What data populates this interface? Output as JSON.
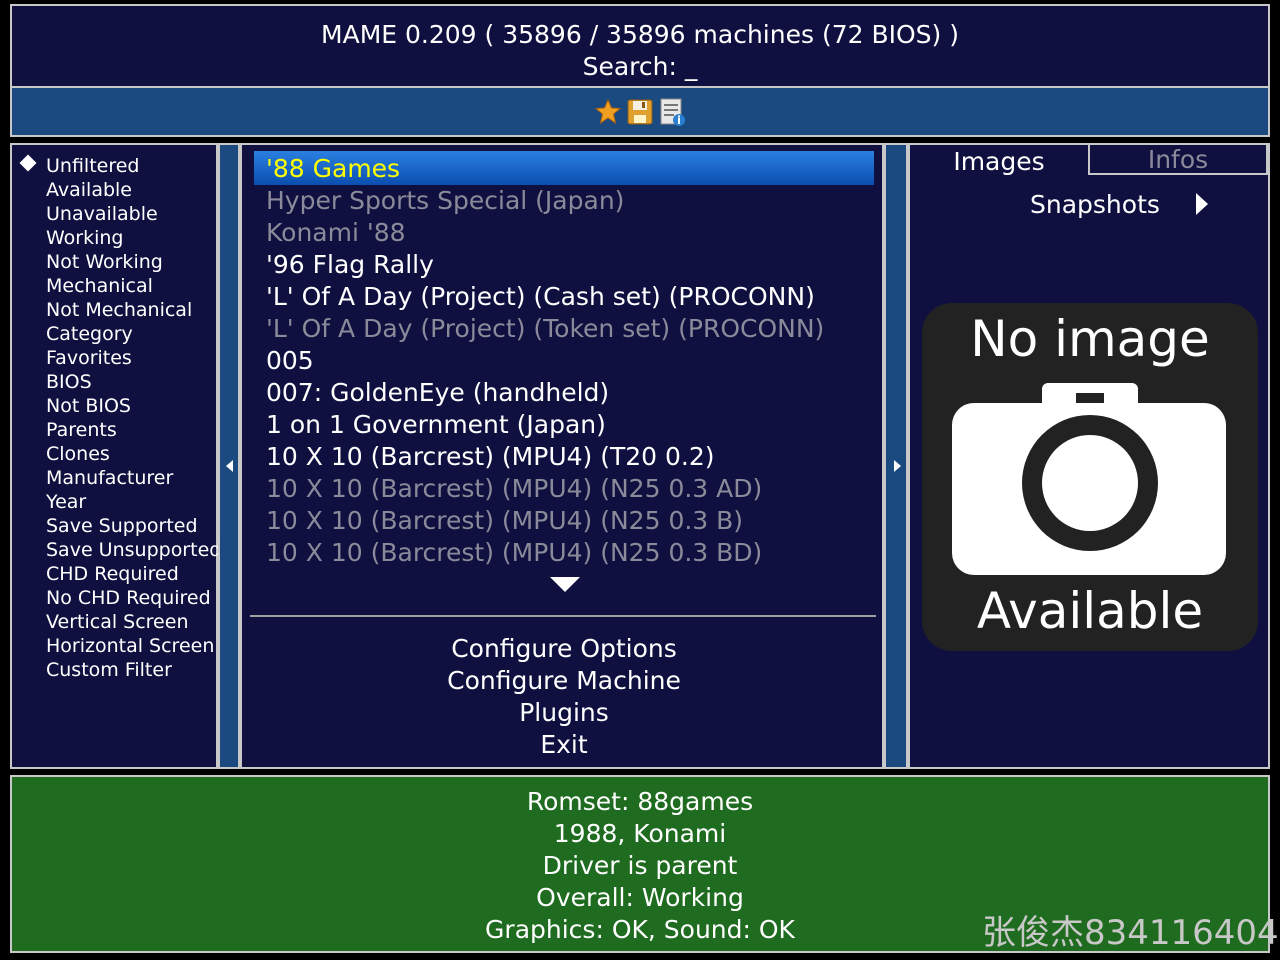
{
  "header": {
    "title": "MAME 0.209 ( 35896 / 35896 machines (72 BIOS) )",
    "search": "Search: _"
  },
  "toolbar": {
    "icons": [
      "star-icon",
      "save-icon",
      "document-info-icon"
    ]
  },
  "filters": {
    "items": [
      "Unfiltered",
      "Available",
      "Unavailable",
      "Working",
      "Not Working",
      "Mechanical",
      "Not Mechanical",
      "Category",
      "Favorites",
      "BIOS",
      "Not BIOS",
      "Parents",
      "Clones",
      "Manufacturer",
      "Year",
      "Save Supported",
      "Save Unsupported",
      "CHD Required",
      "No CHD Required",
      "Vertical Screen",
      "Horizontal Screen",
      "Custom Filter"
    ],
    "selected": "Unfiltered"
  },
  "games": [
    {
      "name": "'88 Games",
      "available": true,
      "selected": true
    },
    {
      "name": "Hyper Sports Special (Japan)",
      "available": false
    },
    {
      "name": "Konami '88",
      "available": false
    },
    {
      "name": "'96 Flag Rally",
      "available": true
    },
    {
      "name": "'L' Of A Day (Project) (Cash set) (PROCONN)",
      "available": true
    },
    {
      "name": "'L' Of A Day (Project) (Token set) (PROCONN)",
      "available": false
    },
    {
      "name": "005",
      "available": true
    },
    {
      "name": "007: GoldenEye (handheld)",
      "available": true
    },
    {
      "name": "1 on 1 Government (Japan)",
      "available": true
    },
    {
      "name": "10 X 10 (Barcrest) (MPU4) (T20 0.2)",
      "available": true
    },
    {
      "name": "10 X 10 (Barcrest) (MPU4) (N25 0.3 AD)",
      "available": false
    },
    {
      "name": "10 X 10 (Barcrest) (MPU4) (N25 0.3 B)",
      "available": false
    },
    {
      "name": "10 X 10 (Barcrest) (MPU4) (N25 0.3 BD)",
      "available": false
    }
  ],
  "menu": [
    "Configure Options",
    "Configure Machine",
    "Plugins",
    "Exit"
  ],
  "side_panel": {
    "tabs": [
      "Images",
      "Infos"
    ],
    "active_tab": "Images",
    "image_type": "Snapshots",
    "placeholder_top": "No image",
    "placeholder_bottom": "Available"
  },
  "info": {
    "lines": [
      "Romset: 88games",
      "1988, Konami",
      "Driver is parent",
      "Overall: Working",
      "Graphics: OK, Sound: OK"
    ]
  },
  "watermark": "张俊杰834116404",
  "colors": {
    "panel_bg": "#101040",
    "accent_blue": "#1a4a80",
    "selection_text": "#ffff00",
    "unavailable_text": "#8a8a9a",
    "info_bg": "#1f6b1f"
  }
}
